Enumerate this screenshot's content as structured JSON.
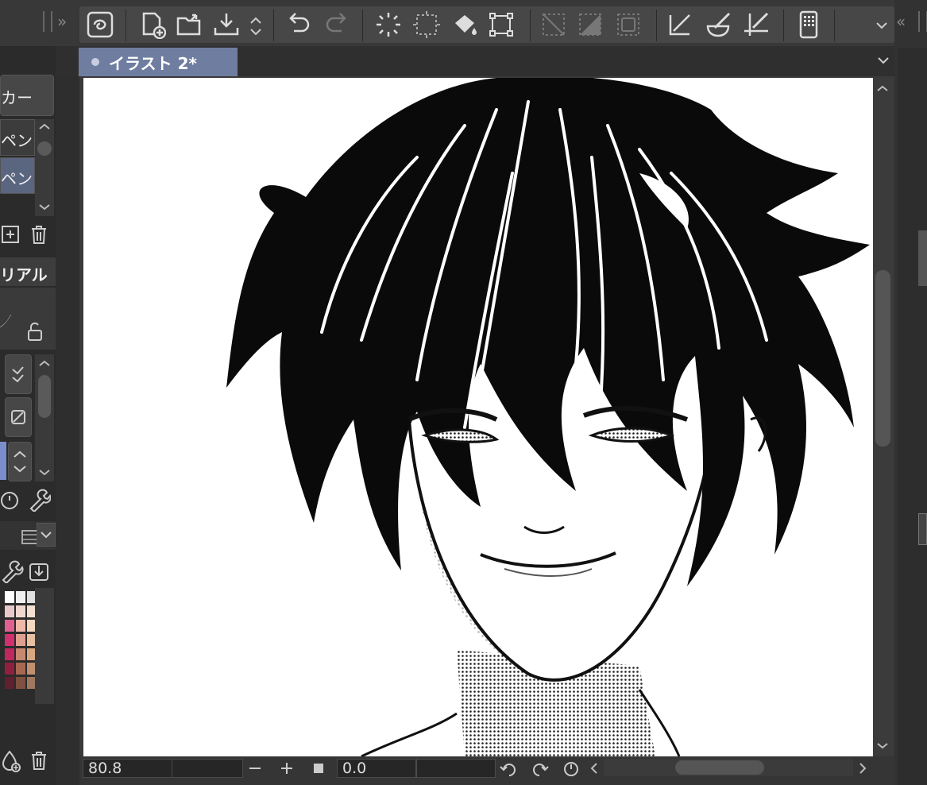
{
  "toolbar": {
    "icons": [
      "clip-studio-logo-icon",
      "new-file-icon",
      "open-folder-icon",
      "save-icon",
      "undo-icon",
      "redo-icon",
      "clear-icon",
      "clear-selection-icon",
      "fill-icon",
      "transform-icon",
      "hide-selection-icon",
      "invert-selection-icon",
      "select-all-icon",
      "ruler-icon",
      "smoothing-icon",
      "snap-icon",
      "companion-icon"
    ],
    "accent": "#6f7ea0"
  },
  "tab": {
    "title": "イラスト 2*"
  },
  "left_panel": {
    "tool_label_1": "カー",
    "sub_tool_1": "ペン",
    "sub_tool_2": "ペン",
    "property_label": "リアル"
  },
  "status": {
    "zoom": "80.8",
    "rotation": "0.0"
  },
  "palette": {
    "colors": [
      "#ffffff",
      "#f0f0f0",
      "#e0e0e0",
      "#e8c8c8",
      "#f0d8d0",
      "#f4e0d0",
      "#e06090",
      "#f0b8a8",
      "#f4d8c0",
      "#d03070",
      "#e0a090",
      "#e8c0a0",
      "#c02860",
      "#c88870",
      "#d8a880",
      "#902040",
      "#a86850",
      "#c09070",
      "#602030",
      "#805040",
      "#a07860"
    ]
  }
}
